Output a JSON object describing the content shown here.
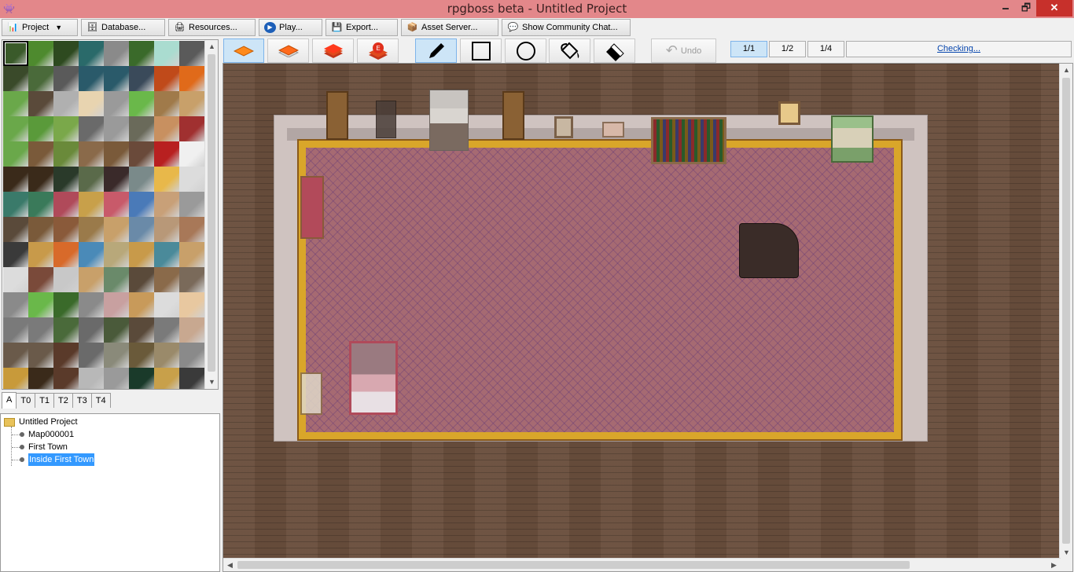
{
  "window": {
    "title": "rpgboss beta - Untitled Project",
    "controls": {
      "minimize": "🗕",
      "maximize": "🗗",
      "close": "✕"
    },
    "app_icon": "👾"
  },
  "menu": {
    "items": [
      {
        "label": "Project",
        "icon": "📊",
        "suffix": "▼"
      },
      {
        "label": "Database...",
        "icon": "🗄"
      },
      {
        "label": "Resources...",
        "icon": "🖨"
      },
      {
        "label": "Play...",
        "icon": "▶"
      },
      {
        "label": "Export...",
        "icon": "💾"
      },
      {
        "label": "Asset Server...",
        "icon": "📦"
      },
      {
        "label": "Show Community Chat...",
        "icon": "💬"
      }
    ]
  },
  "tile_tabs": [
    "A",
    "T0",
    "T1",
    "T2",
    "T3",
    "T4"
  ],
  "tile_tab_active": "A",
  "tree": {
    "root": "Untitled Project",
    "maps": [
      "Map000001",
      "First Town",
      "Inside First Town"
    ],
    "selected": "Inside First Town"
  },
  "editor_toolbar": {
    "layer_tools": [
      "layer-1",
      "layer-2",
      "layer-3",
      "event-layer"
    ],
    "event_layer_mark": "E",
    "draw_tools": [
      "pencil",
      "rectangle",
      "ellipse",
      "fill",
      "eraser"
    ],
    "undo_label": "Undo",
    "undo_icon": "↶",
    "zoom_levels": [
      "1/1",
      "1/2",
      "1/4"
    ],
    "zoom_active": "1/1",
    "status": "Checking..."
  },
  "colors": {
    "titlebar": "#e3878a",
    "close_button": "#c7302b",
    "active_tool": "#cde5f7",
    "selection": "#3399ff",
    "floor": "#6a4f3d",
    "rug": "#a66a72",
    "rug_border": "#d9a62a"
  },
  "scroll_arrows": {
    "up": "▲",
    "down": "▼",
    "left": "◀",
    "right": "▶"
  }
}
